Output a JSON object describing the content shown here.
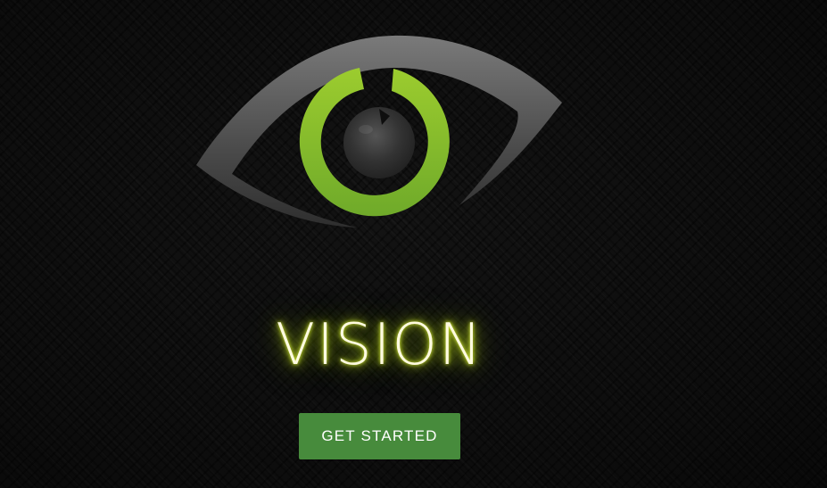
{
  "hero": {
    "title": "VISION",
    "cta_label": "GET STARTED"
  },
  "logo": {
    "icon": "eye-icon",
    "colors": {
      "eye_outline": "#6e6e6e",
      "iris_ring": "#8fc02c",
      "pupil": "#2a2a2a"
    }
  },
  "colors": {
    "background": "#131313",
    "title_glow": "#d7f020",
    "button": "#478b3c",
    "button_text": "#ffffff"
  }
}
